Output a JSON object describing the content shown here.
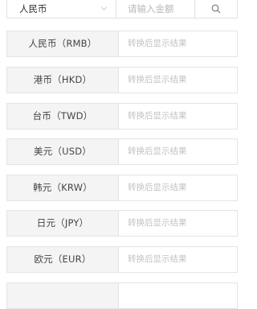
{
  "converter": {
    "currency_select": {
      "value": "人民币"
    },
    "amount_input": {
      "placeholder": "请输入金额"
    }
  },
  "currencies": [
    {
      "label": "人民币（RMB）",
      "result_placeholder": "转换后显示结果"
    },
    {
      "label": "港币（HKD）",
      "result_placeholder": "转换后显示结果"
    },
    {
      "label": "台币（TWD）",
      "result_placeholder": "转换后显示结果"
    },
    {
      "label": "美元（USD）",
      "result_placeholder": "转换后显示结果"
    },
    {
      "label": "韩元（KRW）",
      "result_placeholder": "转换后显示结果"
    },
    {
      "label": "日元（JPY）",
      "result_placeholder": "转换后显示结果"
    },
    {
      "label": "欧元（EUR）",
      "result_placeholder": "转换后显示结果"
    },
    {
      "label": "",
      "result_placeholder": ""
    }
  ],
  "icons": {
    "select_chevron": "chevron-down-icon",
    "search_button": "search-icon"
  },
  "colors": {
    "border": "#e4e4e4",
    "label_bg": "#f4f4f4",
    "placeholder_text": "#c2c2c2"
  }
}
